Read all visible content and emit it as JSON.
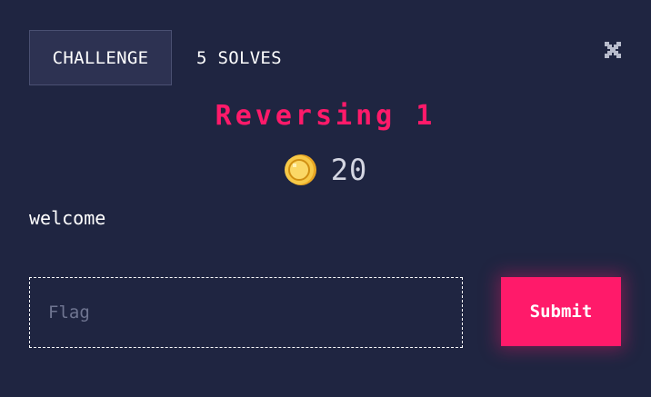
{
  "tabs": {
    "challenge_label": "CHALLENGE",
    "solves_label": "5 SOLVES",
    "active": "challenge"
  },
  "challenge": {
    "title": "Reversing 1",
    "points": "20",
    "description": "welcome"
  },
  "flag_form": {
    "placeholder": "Flag",
    "value": "",
    "submit_label": "Submit"
  },
  "icons": {
    "close": "close-icon",
    "coin": "coin-icon"
  },
  "colors": {
    "background": "#1f2541",
    "accent": "#ff1a6a",
    "tab_active_bg": "#2d3252",
    "coin": "#f7c948"
  }
}
